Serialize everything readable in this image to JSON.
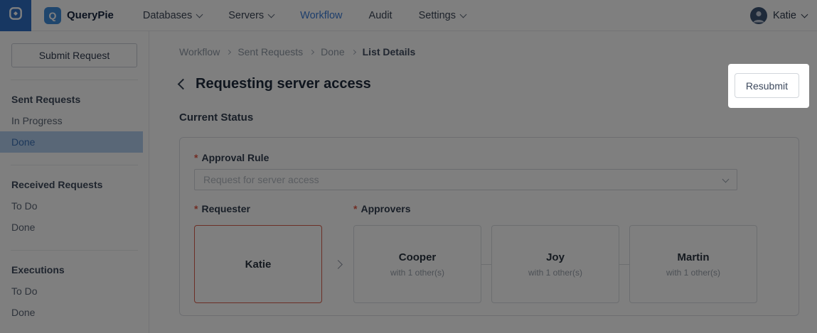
{
  "nav": {
    "logo_letter": "Q",
    "brand": "QueryPie",
    "items": [
      {
        "label": "Databases",
        "dropdown": true
      },
      {
        "label": "Servers",
        "dropdown": true
      },
      {
        "label": "Workflow",
        "active": true
      },
      {
        "label": "Audit"
      },
      {
        "label": "Settings",
        "dropdown": true
      }
    ],
    "user": "Katie"
  },
  "sidebar": {
    "submit_button": "Submit Request",
    "sections": [
      {
        "title": "Sent Requests",
        "items": [
          {
            "label": "In Progress"
          },
          {
            "label": "Done",
            "selected": true
          }
        ]
      },
      {
        "title": "Received Requests",
        "items": [
          {
            "label": "To Do"
          },
          {
            "label": "Done"
          }
        ]
      },
      {
        "title": "Executions",
        "items": [
          {
            "label": "To Do"
          },
          {
            "label": "Done"
          }
        ]
      }
    ]
  },
  "breadcrumb": {
    "items": [
      "Workflow",
      "Sent Requests",
      "Done",
      "List Details"
    ]
  },
  "page": {
    "title": "Requesting server access",
    "resubmit_label": "Resubmit",
    "section_label": "Current Status",
    "required_mark": "*"
  },
  "form": {
    "approval_rule": {
      "label": "Approval Rule",
      "placeholder": "Request for server access"
    },
    "requester": {
      "label": "Requester",
      "name": "Katie"
    },
    "approvers": {
      "label": "Approvers",
      "cards": [
        {
          "name": "Cooper",
          "sub": "with 1 other(s)"
        },
        {
          "name": "Joy",
          "sub": "with 1 other(s)"
        },
        {
          "name": "Martin",
          "sub": "with 1 other(s)"
        }
      ]
    }
  },
  "colors": {
    "brand_strip": "#2f6fc4",
    "logo_chip": "#3f8cdb",
    "nav_active": "#3b7dd8",
    "sidebar_selected_bg": "#b3cfee",
    "sidebar_selected_text": "#3b70b6",
    "required_red": "#e25a48",
    "requester_card_border": "#d95f4c",
    "overlay": "rgba(0,0,0,0.5)"
  }
}
